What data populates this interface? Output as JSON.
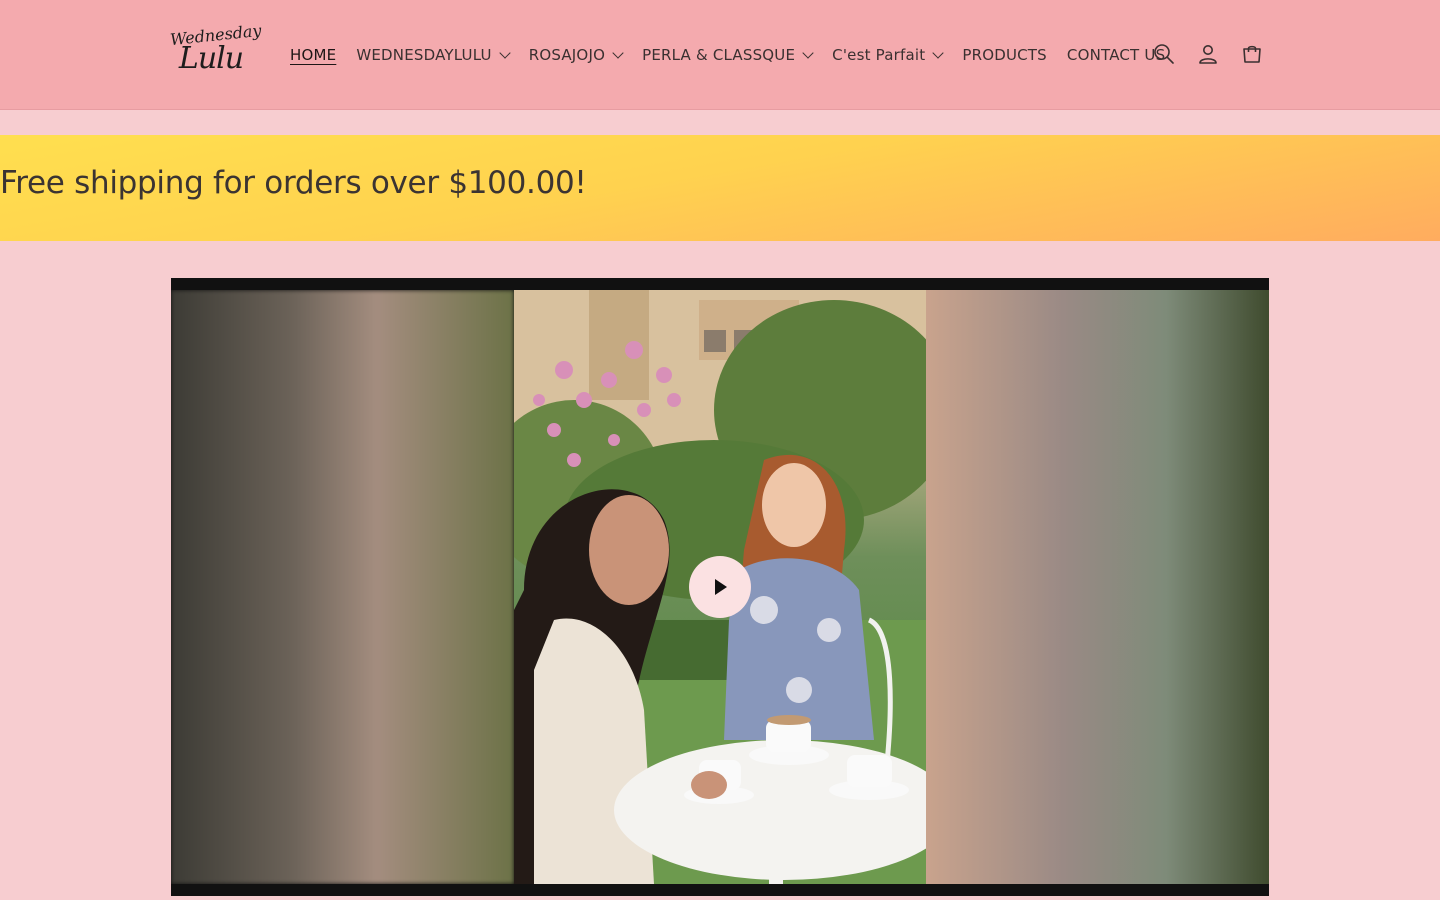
{
  "header": {
    "logo_line1": "Wednesday",
    "logo_line2": "Lulu",
    "nav": [
      {
        "label": "HOME",
        "dropdown": false,
        "active": true
      },
      {
        "label": "WEDNESDAYLULU",
        "dropdown": true,
        "active": false
      },
      {
        "label": "ROSAJOJO",
        "dropdown": true,
        "active": false
      },
      {
        "label": "PERLA & CLASSQUE",
        "dropdown": true,
        "active": false
      },
      {
        "label": "C'est Parfait",
        "dropdown": true,
        "active": false
      },
      {
        "label": "PRODUCTS",
        "dropdown": false,
        "active": false
      },
      {
        "label": "CONTACT US",
        "dropdown": false,
        "active": false
      }
    ],
    "icons": [
      "search-icon",
      "account-icon",
      "cart-icon"
    ]
  },
  "announcement": {
    "text": "Free shipping for orders over $100.00!"
  },
  "video": {
    "play_icon": "play-icon"
  },
  "colors": {
    "header_bg": "#f4aaae",
    "page_bg": "#f7cdd0",
    "band_top": "#ffdf4f",
    "band_bottom": "#ffac5f",
    "play_bg": "#fbe1e2"
  }
}
